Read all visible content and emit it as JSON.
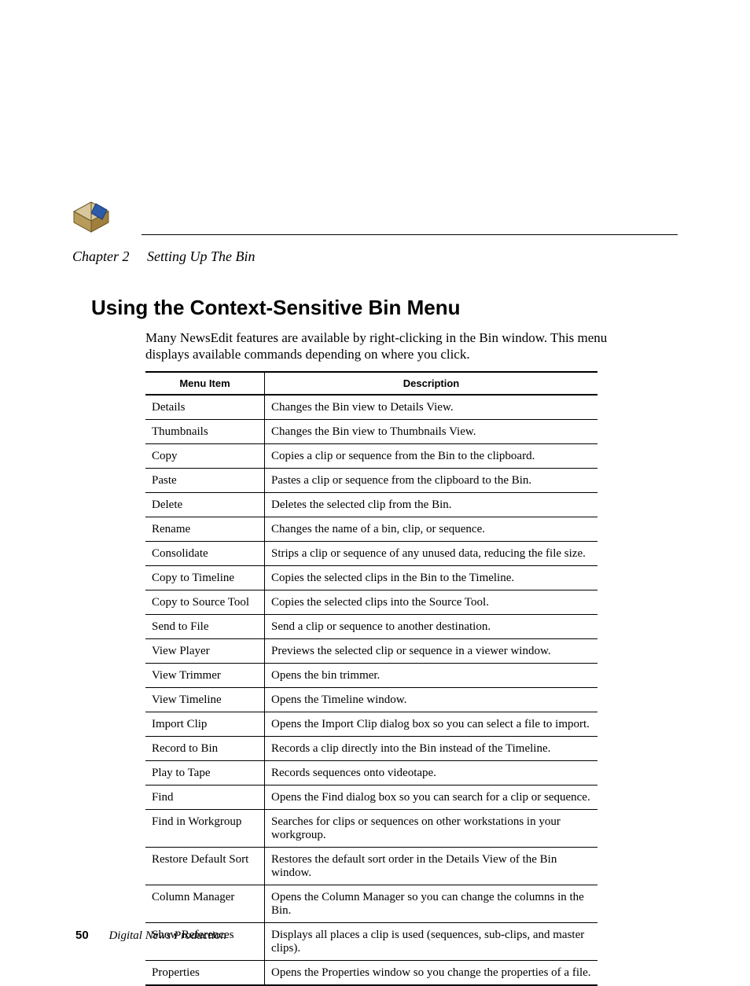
{
  "header": {
    "chapter_label": "Chapter 2",
    "chapter_title": "Setting Up The Bin"
  },
  "section": {
    "title": "Using the Context-Sensitive Bin Menu",
    "intro": "Many NewsEdit features are available by right-clicking in the Bin window. This menu displays available commands depending on where you click."
  },
  "table": {
    "headers": {
      "item": "Menu Item",
      "desc": "Description"
    },
    "rows": [
      {
        "item": "Details",
        "desc": "Changes the Bin view to Details View."
      },
      {
        "item": "Thumbnails",
        "desc": "Changes the Bin view to Thumbnails View."
      },
      {
        "item": "Copy",
        "desc": "Copies a clip or sequence from the Bin to the clipboard."
      },
      {
        "item": "Paste",
        "desc": "Pastes a clip or sequence from the clipboard to the Bin."
      },
      {
        "item": "Delete",
        "desc": "Deletes the selected clip from the Bin."
      },
      {
        "item": "Rename",
        "desc": "Changes the name of a bin, clip, or sequence."
      },
      {
        "item": "Consolidate",
        "desc": "Strips a clip or sequence of any unused data, reducing the file size."
      },
      {
        "item": "Copy to Timeline",
        "desc": "Copies the selected clips in the Bin to the Timeline."
      },
      {
        "item": "Copy to Source Tool",
        "desc": "Copies the selected clips into the Source Tool."
      },
      {
        "item": "Send to File",
        "desc": "Send a clip or sequence to another destination."
      },
      {
        "item": "View Player",
        "desc": "Previews the selected clip or sequence in a viewer window."
      },
      {
        "item": "View Trimmer",
        "desc": "Opens the bin trimmer."
      },
      {
        "item": "View Timeline",
        "desc": "Opens the Timeline window."
      },
      {
        "item": "Import Clip",
        "desc": "Opens the Import Clip dialog box so you can select a file to import."
      },
      {
        "item": "Record to Bin",
        "desc": "Records a clip directly into the Bin instead of the Timeline."
      },
      {
        "item": "Play to Tape",
        "desc": "Records sequences onto videotape."
      },
      {
        "item": "Find",
        "desc": "Opens the Find dialog box so you can search for a clip or sequence."
      },
      {
        "item": "Find in Workgroup",
        "desc": "Searches for clips or sequences on other workstations in your workgroup."
      },
      {
        "item": "Restore Default Sort",
        "desc": "Restores the default sort order in the Details View of the Bin window."
      },
      {
        "item": "Column Manager",
        "desc": "Opens the Column Manager so you can change the columns in the Bin."
      },
      {
        "item": "Show References",
        "desc": "Displays all places a clip is used (sequences, sub-clips, and master clips)."
      },
      {
        "item": "Properties",
        "desc": "Opens the Properties window so you change the properties of a file."
      }
    ]
  },
  "footer": {
    "page_number": "50",
    "book_title": "Digital News Production"
  }
}
